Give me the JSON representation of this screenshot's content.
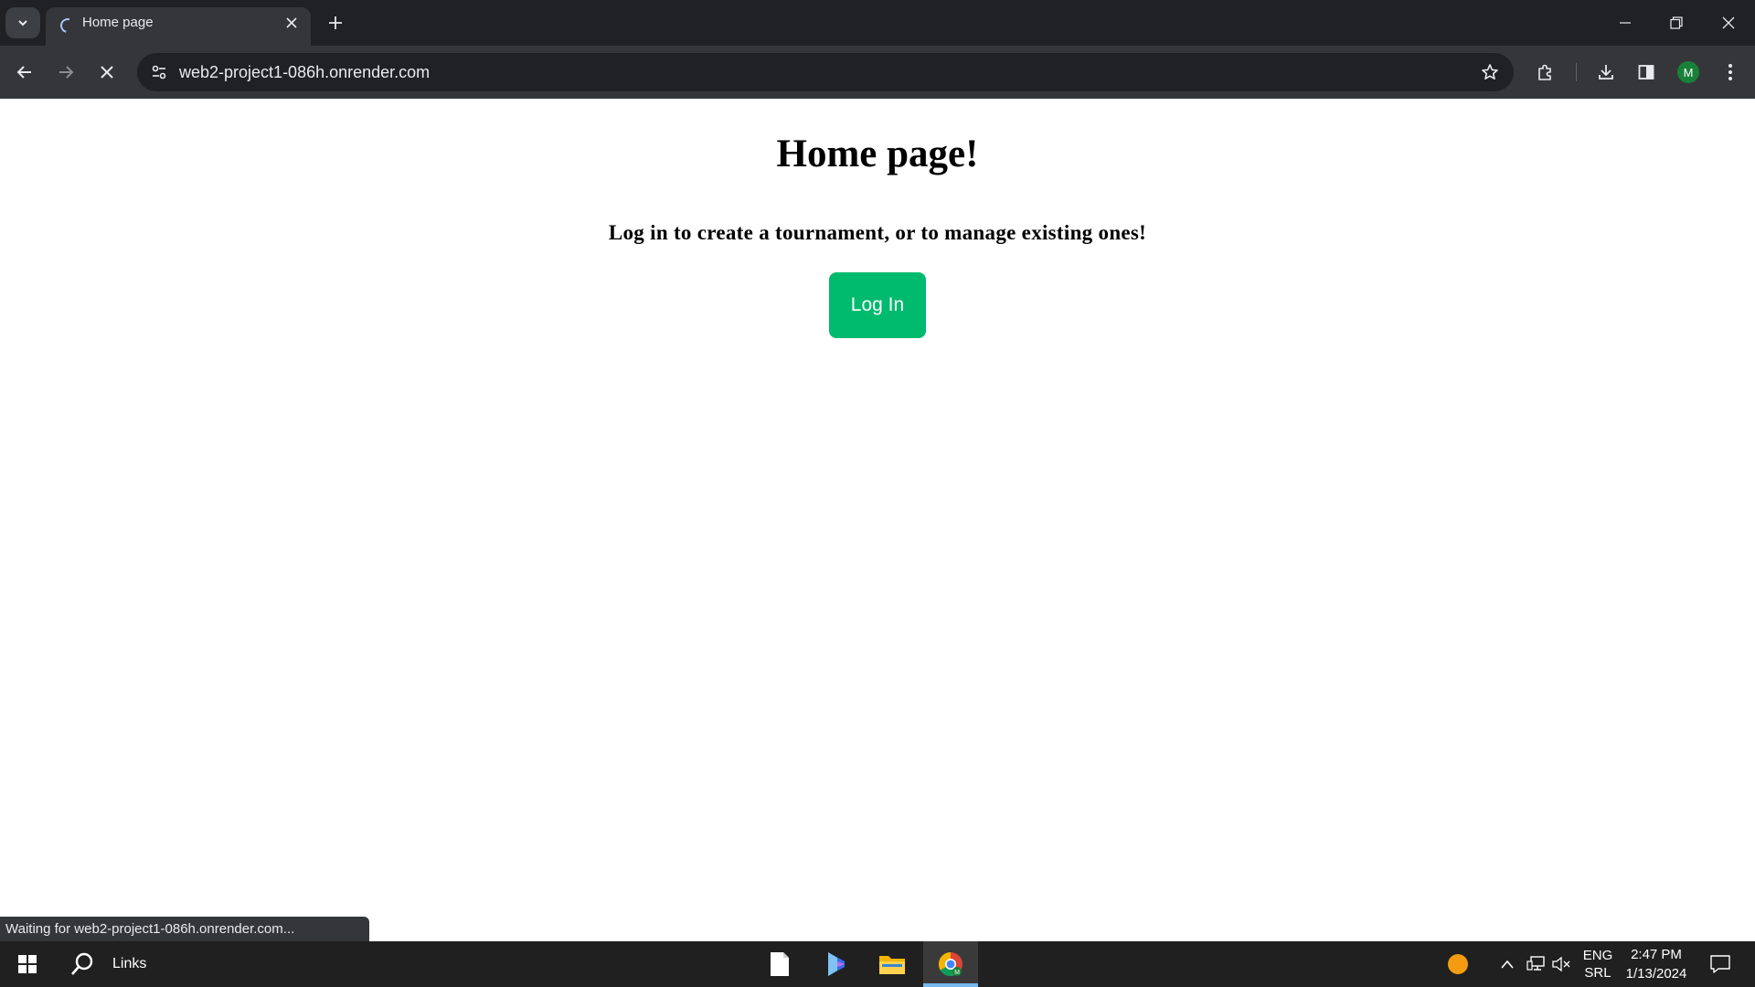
{
  "browser": {
    "tab": {
      "title": "Home page"
    },
    "address_bar": {
      "url": "web2-project1-086h.onrender.com"
    },
    "profile": {
      "initial": "M"
    },
    "status_bubble": "Waiting for web2-project1-086h.onrender.com..."
  },
  "page": {
    "heading": "Home page!",
    "subtitle": "Log in to create a tournament, or to manage existing ones!",
    "login_button": "Log In",
    "accent_color": "#00ba6e"
  },
  "taskbar": {
    "search_label": "Links",
    "language": {
      "line1": "ENG",
      "line2": "SRL"
    },
    "clock": {
      "time": "2:47 PM",
      "date": "1/13/2024"
    },
    "pinned_apps": [
      "notepad-icon",
      "copilot-icon",
      "file-explorer-icon",
      "chrome-icon"
    ]
  }
}
